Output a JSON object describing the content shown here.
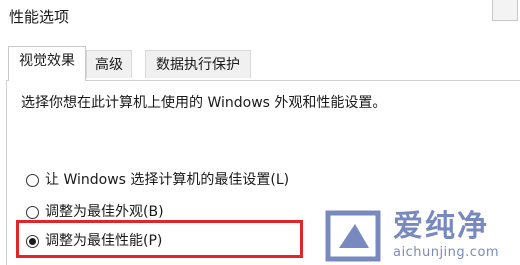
{
  "window": {
    "title": "性能选项"
  },
  "tabs": [
    {
      "label": "视觉效果",
      "active": true
    },
    {
      "label": "高级",
      "active": false
    },
    {
      "label": "数据执行保护",
      "active": false
    }
  ],
  "visual_effects": {
    "description": "选择你想在此计算机上使用的 Windows 外观和性能设置。",
    "options": [
      {
        "label": "让 Windows 选择计算机的最佳设置(L)",
        "checked": false
      },
      {
        "label": "调整为最佳外观(B)",
        "checked": false
      },
      {
        "label": "调整为最佳性能(P)",
        "checked": true
      }
    ]
  },
  "annotation": {
    "highlight_color": "#e0262a"
  },
  "watermark": {
    "title": "爱纯净",
    "url": "aichunjing.com",
    "icon": "watermark-logo-icon"
  }
}
